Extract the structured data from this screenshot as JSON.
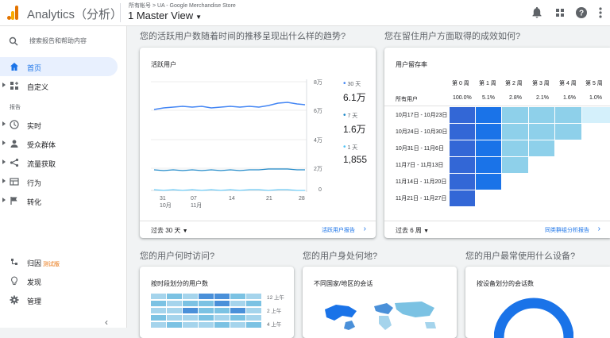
{
  "app": {
    "title": "Analytics（分析）",
    "breadcrumb": "所有帐号 > UA - Google Merchandise Store",
    "view": "1 Master View",
    "icons": [
      "bell-icon",
      "apps-grid-icon",
      "help-icon",
      "more-vert-icon"
    ],
    "brand_colors": [
      "#f9ab00",
      "#e37400"
    ]
  },
  "sidebar": {
    "search_placeholder": "搜索报告和帮助内容",
    "top_items": [
      {
        "label": "首页",
        "icon": "home-icon",
        "active": true
      },
      {
        "label": "自定义",
        "icon": "customize-icon",
        "active": false
      }
    ],
    "reports_heading": "报告",
    "report_items": [
      {
        "label": "实时",
        "icon": "clock-icon"
      },
      {
        "label": "受众群体",
        "icon": "person-icon"
      },
      {
        "label": "流量获取",
        "icon": "acquisition-icon"
      },
      {
        "label": "行为",
        "icon": "behavior-icon"
      },
      {
        "label": "转化",
        "icon": "flag-icon"
      }
    ],
    "bottom_items": [
      {
        "label": "归因",
        "badge": "测试版",
        "icon": "attribution-icon"
      },
      {
        "label": "发现",
        "icon": "lightbulb-icon"
      },
      {
        "label": "管理",
        "icon": "gear-icon"
      }
    ],
    "collapse_label": "‹"
  },
  "questions": {
    "trend": "您的活跃用户数随着时间的推移呈现出什么样的趋势?",
    "retention": "您在留住用户方面取得的成效如何?",
    "when": "您的用户何时访问?",
    "where": "您的用户身处何地?",
    "device": "您的用户最常使用什么设备?"
  },
  "active_users": {
    "title": "活跃用户",
    "y_ticks": [
      "8万",
      "6万",
      "4万",
      "2万",
      "0"
    ],
    "x_ticks": [
      {
        "day": "31",
        "month": "10月"
      },
      {
        "day": "07",
        "month": "11月"
      },
      {
        "day": "14",
        "month": ""
      },
      {
        "day": "21",
        "month": ""
      },
      {
        "day": "28",
        "month": ""
      }
    ],
    "legend": [
      {
        "name": "30 天",
        "value": "6.1万",
        "color": "#4285f4"
      },
      {
        "name": "7 天",
        "value": "1.6万",
        "color": "#1e88c8"
      },
      {
        "name": "1 天",
        "value": "1,855",
        "color": "#4fc3f7"
      }
    ],
    "range": "过去 30 天",
    "link": "活跃用户报告"
  },
  "retention": {
    "title": "用户留存率",
    "columns": [
      "第 0 周",
      "第 1 周",
      "第 2 周",
      "第 3 周",
      "第 4 周",
      "第 5 周"
    ],
    "all_users_label": "所有用户",
    "all_users_values": [
      "100.0%",
      "5.1%",
      "2.8%",
      "2.1%",
      "1.6%",
      "1.0%"
    ],
    "rows": [
      "10月17日 - 10月23日",
      "10月24日 - 10月30日",
      "10月31日 - 11月6日",
      "11月7日 - 11月13日",
      "11月14日 - 11月20日",
      "11月21日 - 11月27日"
    ],
    "range": "过去 6 周",
    "link": "同类群组分析报告"
  },
  "hours_card": {
    "title": "按时段划分的用户数",
    "time_labels": [
      "12 上午",
      "2 上午",
      "4 上午"
    ]
  },
  "geo_card": {
    "title": "不同国家/地区的会话"
  },
  "device_card": {
    "title": "按设备划分的会话数"
  }
}
